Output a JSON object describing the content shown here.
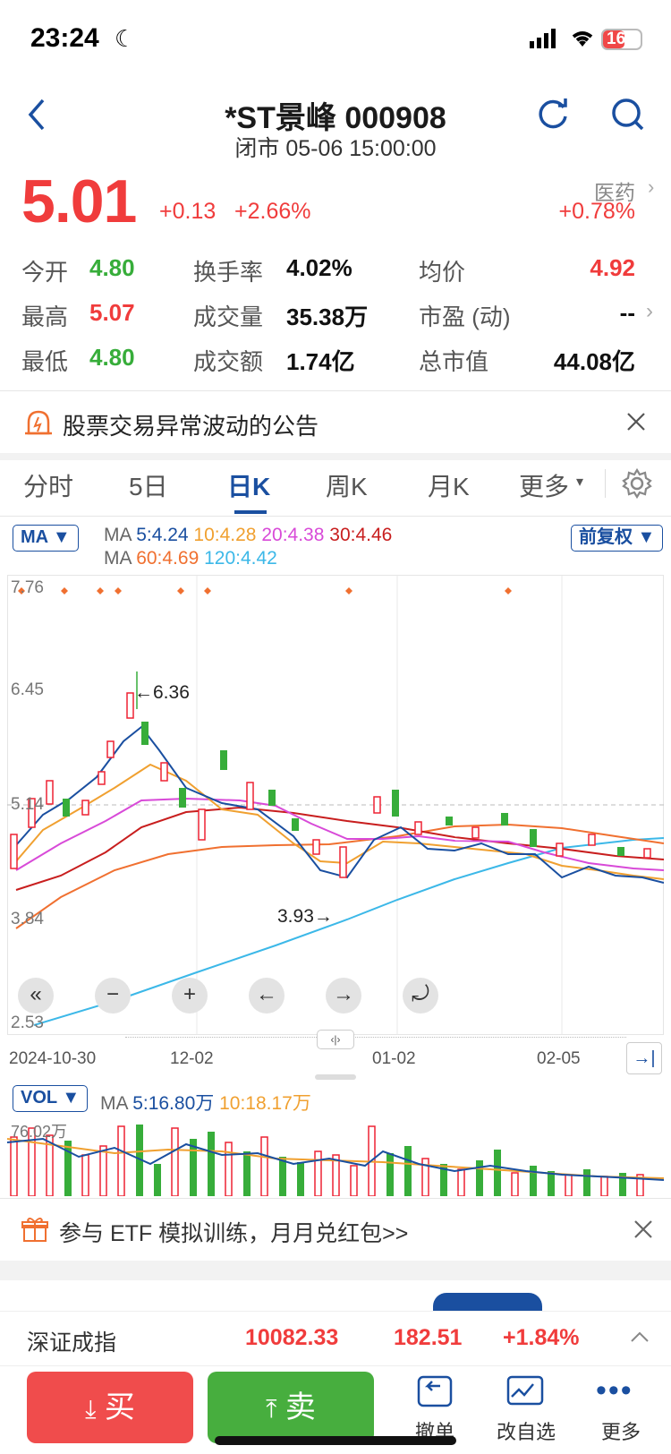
{
  "status": {
    "time": "23:24",
    "battery": "16"
  },
  "header": {
    "title": "*ST景峰 000908",
    "subtitle": "闭市 05-06 15:00:00"
  },
  "quote": {
    "price": "5.01",
    "change": "+0.13",
    "change_pct": "+2.66%",
    "sector_name": "医药",
    "sector_pct": "+0.78%",
    "colors": {
      "up": "#f03c3c",
      "down": "#37ad3a",
      "accent": "#1a4fa0"
    }
  },
  "stats": [
    {
      "label": "今开",
      "value": "4.80",
      "tone": "green"
    },
    {
      "label": "换手率",
      "value": "4.02%",
      "tone": "blk"
    },
    {
      "label": "均价",
      "value": "4.92",
      "tone": "red"
    },
    {
      "label": "最高",
      "value": "5.07",
      "tone": "red"
    },
    {
      "label": "成交量",
      "value": "35.38万",
      "tone": "blk"
    },
    {
      "label": "市盈 (动)",
      "value": "--",
      "tone": "blk"
    },
    {
      "label": "最低",
      "value": "4.80",
      "tone": "green"
    },
    {
      "label": "成交额",
      "value": "1.74亿",
      "tone": "blk"
    },
    {
      "label": "总市值",
      "value": "44.08亿",
      "tone": "blk"
    }
  ],
  "notice": {
    "text": "股票交易异常波动的公告"
  },
  "tabs": [
    "分时",
    "5日",
    "日K",
    "周K",
    "月K",
    "更多"
  ],
  "active_tab": "日K",
  "kline": {
    "ma_chip": "MA",
    "adjust_chip": "前复权",
    "ma_line1": [
      {
        "text": "MA",
        "color": "#666"
      },
      {
        "text": "5:4.24",
        "color": "#1a4fa0"
      },
      {
        "text": "10:4.28",
        "color": "#f0a030"
      },
      {
        "text": "20:4.38",
        "color": "#d84ad8"
      },
      {
        "text": "30:4.46",
        "color": "#c81e1e"
      }
    ],
    "ma_line2": [
      {
        "text": "MA",
        "color": "#666"
      },
      {
        "text": "60:4.69",
        "color": "#f07030"
      },
      {
        "text": "120:4.42",
        "color": "#3cb8e8"
      }
    ],
    "y_labels": [
      "7.76",
      "6.45",
      "5.14",
      "3.84",
      "2.53"
    ],
    "high_annot": "←6.36",
    "low_annot": "3.93→",
    "dates": [
      "2024-10-30",
      "12-02",
      "01-02",
      "02-05"
    ],
    "controls": [
      "«",
      "−",
      "+",
      "←",
      "→",
      "⤾"
    ]
  },
  "chart_data": {
    "type": "candlestick",
    "y_axis_ticks": [
      7.76,
      6.45,
      5.14,
      3.84,
      2.53
    ],
    "x_ticks": [
      "2024-10-30",
      "12-02",
      "01-02",
      "02-05"
    ],
    "annotations": {
      "high": 6.36,
      "low": 3.93
    },
    "moving_averages": {
      "MA5": 4.24,
      "MA10": 4.28,
      "MA20": 4.38,
      "MA30": 4.46,
      "MA60": 4.69,
      "MA120": 4.42
    }
  },
  "volume": {
    "chip": "VOL",
    "ma_items": [
      {
        "text": "MA",
        "color": "#666"
      },
      {
        "text": "5:16.80万",
        "color": "#1a4fa0"
      },
      {
        "text": "10:18.17万",
        "color": "#f0a030"
      }
    ],
    "max_label": "76.02万"
  },
  "promo": {
    "text": "参与 ETF 模拟训练，月月兑红包>>"
  },
  "index_bar": {
    "name": "深证成指",
    "value": "10082.33",
    "change": "182.51",
    "pct": "+1.84%"
  },
  "bottom": {
    "buy": "买",
    "sell": "卖",
    "cancel": "撤单",
    "edit_watch": "改自选",
    "more": "更多"
  }
}
